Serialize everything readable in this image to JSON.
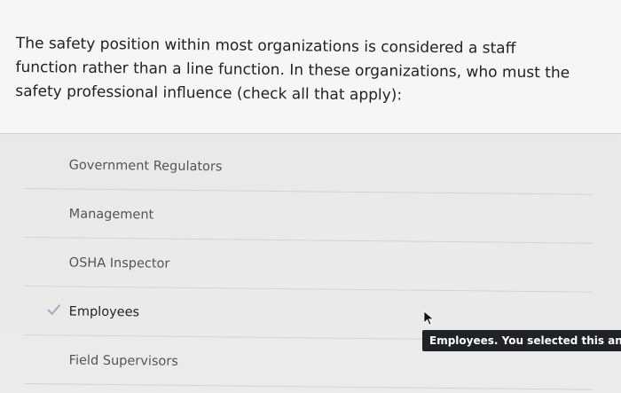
{
  "question": {
    "text": "The safety position within most organizations is considered a staff function rather than a line function.  In these organizations, who must the safety professional influence (check all that apply):"
  },
  "choices": [
    {
      "label": "Government Regulators",
      "selected": false
    },
    {
      "label": "Management",
      "selected": false
    },
    {
      "label": "OSHA Inspector",
      "selected": false
    },
    {
      "label": "Employees",
      "selected": true
    },
    {
      "label": "Field Supervisors",
      "selected": false
    }
  ],
  "tooltip": {
    "text": "Employees. You selected this answer"
  },
  "icons": {
    "check": "check-icon",
    "cursor": "mouse-pointer-icon"
  },
  "colors": {
    "check": "#9fb0c8",
    "tooltip_bg": "#1f2226"
  }
}
